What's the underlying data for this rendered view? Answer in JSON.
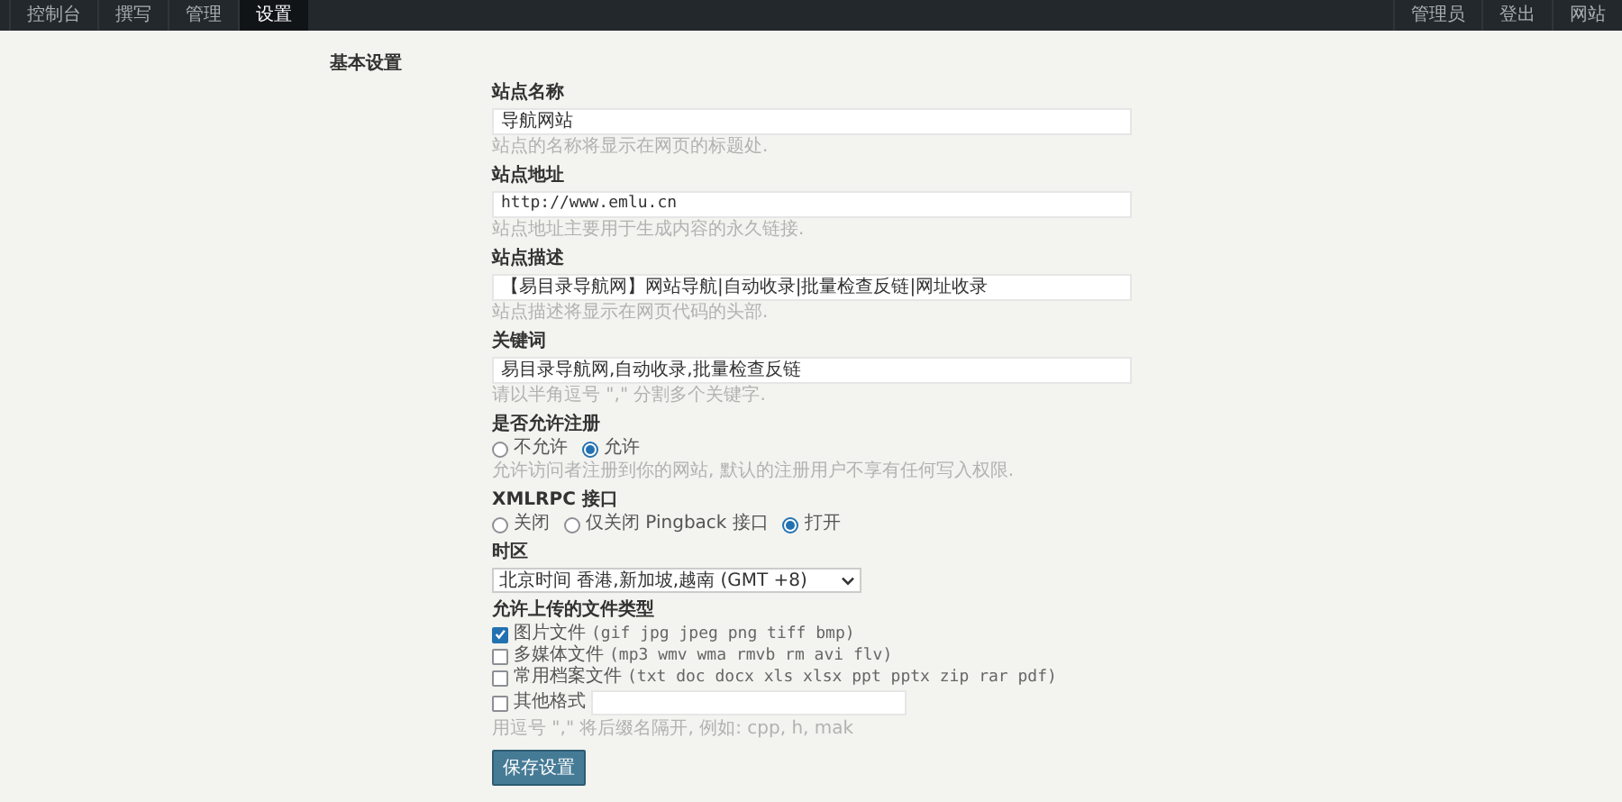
{
  "nav": {
    "left": [
      {
        "label": "控制台",
        "selected": false
      },
      {
        "label": "撰写",
        "selected": false
      },
      {
        "label": "管理",
        "selected": false
      },
      {
        "label": "设置",
        "selected": true
      }
    ],
    "right": [
      {
        "label": "管理员"
      },
      {
        "label": "登出"
      },
      {
        "label": "网站"
      }
    ]
  },
  "page_title": "基本设置",
  "fields": [
    {
      "kind": "text",
      "label": "站点名称",
      "value": "导航网站",
      "help": "站点的名称将显示在网页的标题处."
    },
    {
      "kind": "url",
      "label": "站点地址",
      "value": "http://www.emlu.cn",
      "help": "站点地址主要用于生成内容的永久链接."
    },
    {
      "kind": "text",
      "label": "站点描述",
      "value": "【易目录导航网】网站导航|自动收录|批量检查反链|网址收录",
      "help": "站点描述将显示在网页代码的头部."
    },
    {
      "kind": "text",
      "label": "关键词",
      "value": "易目录导航网,自动收录,批量检查反链",
      "help": "请以半角逗号 \",\" 分割多个关键字."
    },
    {
      "kind": "radio",
      "label": "是否允许注册",
      "options": [
        {
          "label": "不允许",
          "selected": false
        },
        {
          "label": "允许",
          "selected": true
        }
      ],
      "help": "允许访问者注册到你的网站, 默认的注册用户不享有任何写入权限."
    },
    {
      "kind": "radio",
      "label": "XMLRPC 接口",
      "options": [
        {
          "label": "关闭",
          "selected": false
        },
        {
          "label": "仅关闭 Pingback 接口",
          "selected": false
        },
        {
          "label": "打开",
          "selected": true
        }
      ]
    },
    {
      "kind": "select",
      "label": "时区",
      "value": "北京时间 香港,新加坡,越南 (GMT +8)"
    },
    {
      "kind": "checkboxes",
      "label": "允许上传的文件类型",
      "options": [
        {
          "kind": "check",
          "label": "图片文件",
          "types": "(gif jpg jpeg png tiff bmp)",
          "checked": true
        },
        {
          "kind": "check",
          "label": "多媒体文件",
          "types": "(mp3 wmv wma rmvb rm avi flv)",
          "checked": false
        },
        {
          "kind": "check",
          "label": "常用档案文件",
          "types": "(txt doc docx xls xlsx ppt pptx zip rar pdf)",
          "checked": false
        },
        {
          "kind": "check_input",
          "label": "其他格式",
          "checked": false
        }
      ],
      "help": "用逗号 \",\" 将后缀名隔开, 例如: cpp, h, mak"
    }
  ],
  "save_button": "保存设置"
}
